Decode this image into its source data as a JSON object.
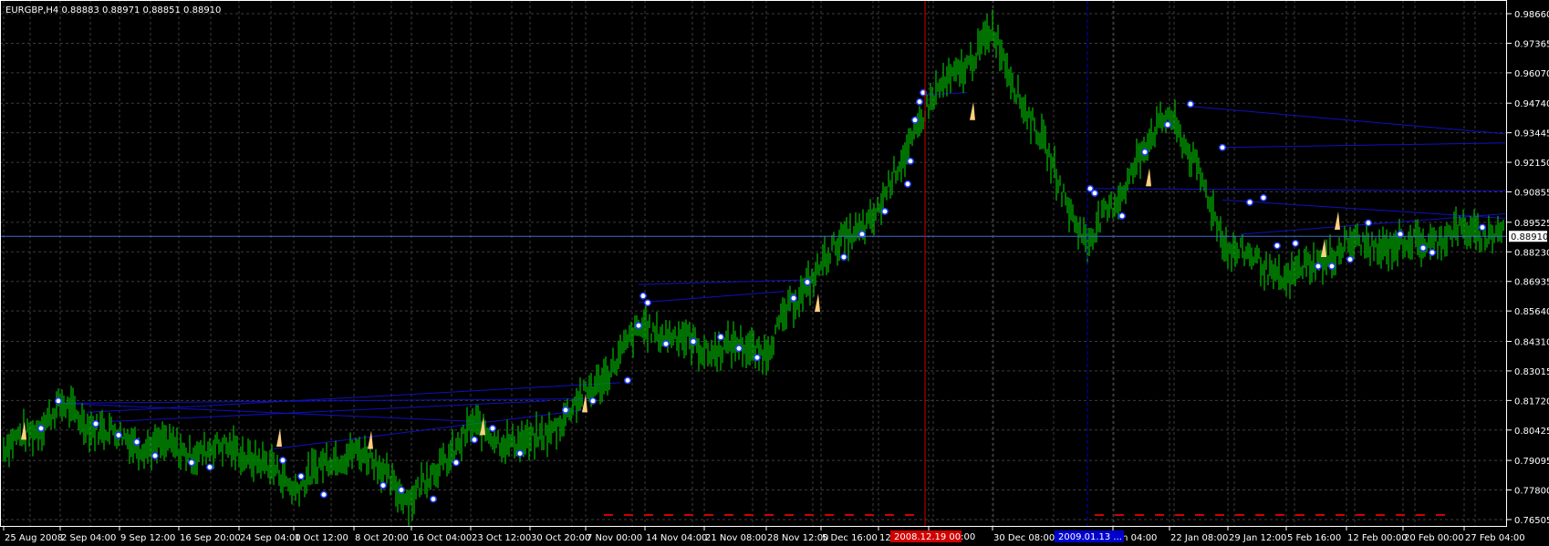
{
  "chart_header": {
    "symbol_timeframe": "EURGBP,H4",
    "ohlc": "0.88883 0.88971 0.88851 0.88910"
  },
  "price_axis_labels": [
    "0.98660",
    "0.97365",
    "0.96070",
    "0.94740",
    "0.93445",
    "0.92150",
    "0.90855",
    "0.89525",
    "0.88230",
    "0.86935",
    "0.85640",
    "0.84310",
    "0.83015",
    "0.81720",
    "0.80425",
    "0.79095",
    "0.77800",
    "0.76505"
  ],
  "current_price_label": "0.88910",
  "time_axis_labels": [
    "25 Aug 2008",
    "2 Sep 04:00",
    "9 Sep 12:00",
    "16 Sep 20:00",
    "24 Sep 04:00",
    "1 Oct 12:00",
    "8 Oct 20:00",
    "16 Oct 04:00",
    "23 Oct 12:00",
    "30 Oct 20:00",
    "7 Nov 00:00",
    "14 Nov 04:00",
    "21 Nov 08:00",
    "28 Nov 12:00",
    "5 Dec 16:00",
    "12",
    "00:00",
    "30 Dec 08:00",
    "Jan 04:00",
    "22 Jan 08:00",
    "29 Jan 12:00",
    "5 Feb 16:00",
    "12 Feb 00:00",
    "20 Feb 00:00",
    "27 Feb 04:00"
  ],
  "time_markers": {
    "red_marker_label": "2008.12.19 00:00",
    "blue_marker_label": "2009.01.13 ..."
  },
  "colors": {
    "background": "#000000",
    "grid": "#3c3c3c",
    "bars": "#00a000",
    "axis_text": "#ffffff",
    "current_price_line": "#3c6ccc",
    "red_vertical_line": "#d00000",
    "blue_vertical_line": "#0000cc",
    "signal_marker": "#ffffff",
    "signal_marker_border": "#2040ff",
    "yellow_arrows": "#ffd080",
    "trend_lines": "#1010c0"
  },
  "chart_data": {
    "type": "line",
    "title": "EURGBP,H4",
    "xlabel": "",
    "ylabel": "",
    "ylim": [
      0.76505,
      0.9866
    ],
    "grid": true,
    "current_price": 0.8891,
    "x": [
      "25 Aug 2008",
      "2 Sep 04:00",
      "9 Sep 12:00",
      "16 Sep 20:00",
      "24 Sep 04:00",
      "1 Oct 12:00",
      "8 Oct 20:00",
      "16 Oct 04:00",
      "23 Oct 12:00",
      "30 Oct 20:00",
      "7 Nov 00:00",
      "14 Nov 04:00",
      "21 Nov 08:00",
      "28 Nov 12:00",
      "5 Dec 16:00",
      "12 Dec",
      "19 Dec",
      "30 Dec 08:00",
      "13 Jan",
      "22 Jan 08:00",
      "29 Jan 12:00",
      "5 Feb 16:00",
      "12 Feb 00:00",
      "20 Feb 00:00",
      "27 Feb 04:00"
    ],
    "series": [
      {
        "values": [
          0.795,
          0.814,
          0.801,
          0.795,
          0.796,
          0.78,
          0.797,
          0.774,
          0.805,
          0.797,
          0.819,
          0.85,
          0.84,
          0.84,
          0.878,
          0.9,
          0.945,
          0.978,
          0.885,
          0.945,
          0.885,
          0.87,
          0.885,
          0.885,
          0.891
        ]
      }
    ]
  }
}
